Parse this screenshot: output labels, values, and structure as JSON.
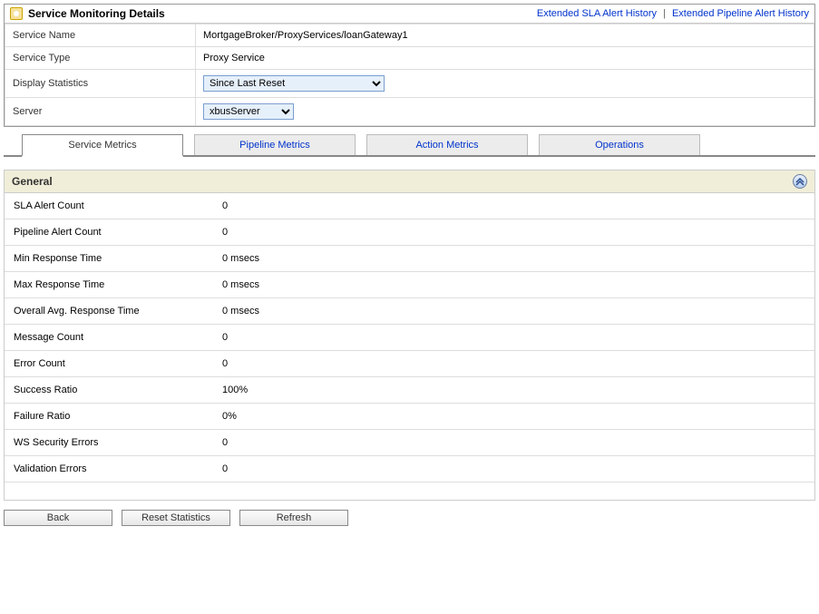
{
  "header": {
    "title": "Service Monitoring Details",
    "links": {
      "sla": "Extended SLA Alert History",
      "pipeline": "Extended Pipeline Alert History"
    }
  },
  "details": {
    "service_name_label": "Service Name",
    "service_name_value": "MortgageBroker/ProxyServices/loanGateway1",
    "service_type_label": "Service Type",
    "service_type_value": "Proxy Service",
    "display_stats_label": "Display Statistics",
    "display_stats_value": "Since Last Reset",
    "server_label": "Server",
    "server_value": "xbusServer"
  },
  "tabs": {
    "service_metrics": "Service Metrics",
    "pipeline_metrics": "Pipeline Metrics",
    "action_metrics": "Action Metrics",
    "operations": "Operations"
  },
  "general": {
    "title": "General",
    "rows": {
      "sla_alert_count_label": "SLA Alert Count",
      "sla_alert_count_value": "0",
      "pipeline_alert_count_label": "Pipeline Alert Count",
      "pipeline_alert_count_value": "0",
      "min_response_label": "Min Response Time",
      "min_response_value": "0 msecs",
      "max_response_label": "Max Response Time",
      "max_response_value": "0 msecs",
      "avg_response_label": "Overall Avg. Response Time",
      "avg_response_value": "0 msecs",
      "message_count_label": "Message Count",
      "message_count_value": "0",
      "error_count_label": "Error Count",
      "error_count_value": "0",
      "success_ratio_label": "Success Ratio",
      "success_ratio_value": "100%",
      "failure_ratio_label": "Failure Ratio",
      "failure_ratio_value": "0%",
      "ws_security_label": "WS Security Errors",
      "ws_security_value": "0",
      "validation_label": "Validation Errors",
      "validation_value": "0"
    }
  },
  "buttons": {
    "back": "Back",
    "reset": "Reset Statistics",
    "refresh": "Refresh"
  }
}
